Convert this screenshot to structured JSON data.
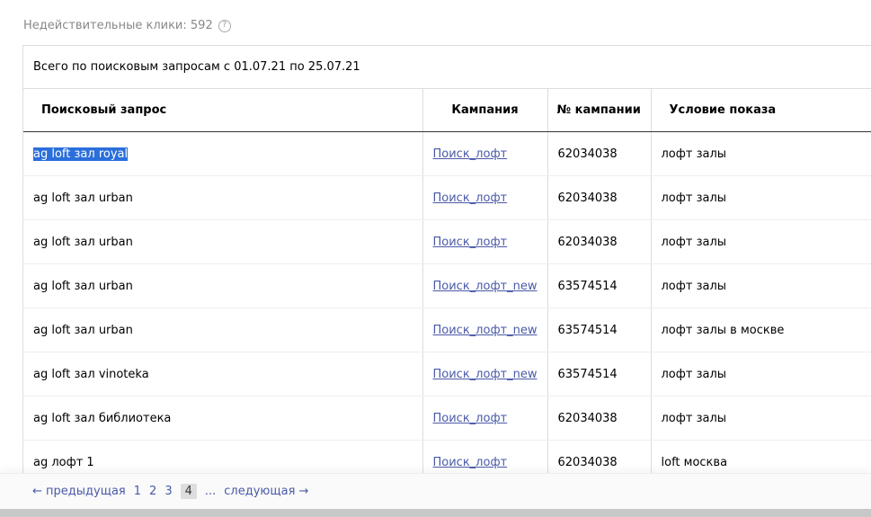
{
  "invalid_clicks": "Недействительные клики: 592",
  "help_glyph": "?",
  "summary": "Всего по поисковым запросам с 01.07.21 по 25.07.21",
  "table": {
    "headers": {
      "query": "Поисковый запрос",
      "campaign": "Кампания",
      "campaign_no": "№ кампании",
      "condition": "Условие показа"
    },
    "rows": [
      {
        "query": "ag loft зал royal",
        "campaign": "Поиск_лофт",
        "campaign_no": "62034038",
        "condition": "лофт залы"
      },
      {
        "query": "ag loft зал urban",
        "campaign": "Поиск_лофт",
        "campaign_no": "62034038",
        "condition": "лофт залы"
      },
      {
        "query": "ag loft зал urban",
        "campaign": "Поиск_лофт",
        "campaign_no": "62034038",
        "condition": "лофт залы"
      },
      {
        "query": "ag loft зал urban",
        "campaign": "Поиск_лофт_new",
        "campaign_no": "63574514",
        "condition": "лофт залы"
      },
      {
        "query": "ag loft зал urban",
        "campaign": "Поиск_лофт_new",
        "campaign_no": "63574514",
        "condition": "лофт залы в москве"
      },
      {
        "query": "ag loft зал vinoteka",
        "campaign": "Поиск_лофт_new",
        "campaign_no": "63574514",
        "condition": "лофт залы"
      },
      {
        "query": "ag loft зал библиотека",
        "campaign": "Поиск_лофт",
        "campaign_no": "62034038",
        "condition": "лофт залы"
      },
      {
        "query": "ag лофт 1",
        "campaign": "Поиск_лофт",
        "campaign_no": "62034038",
        "condition": "loft москва"
      }
    ]
  },
  "pagination": {
    "prev": "← предыдущая",
    "pages": [
      "1",
      "2",
      "3",
      "4"
    ],
    "current": "4",
    "ellipsis": "...",
    "next": "следующая →"
  },
  "colors": {
    "link": "#4a5aa8",
    "selection": "#2a6fdb",
    "muted_text": "#888888"
  }
}
